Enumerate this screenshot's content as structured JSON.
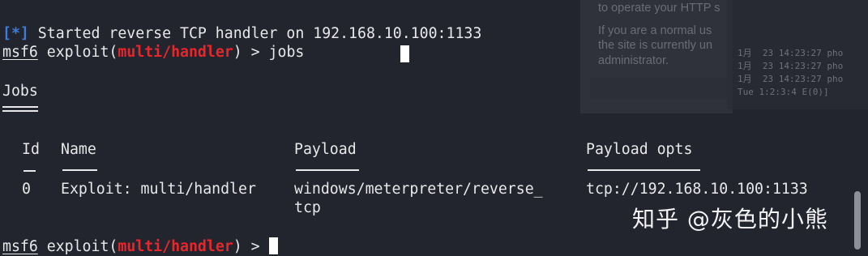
{
  "terminal": {
    "status_bracket": "[*]",
    "status_message": " Started reverse TCP handler on 192.168.10.100:1133",
    "prompt": {
      "msf": "msf6",
      "exploit_pre": " exploit(",
      "module": "multi/handler",
      "exploit_post": ") > "
    },
    "first_command": "jobs",
    "jobs_heading": "Jobs",
    "jobs_table": {
      "headers": {
        "id": "Id",
        "name": "Name",
        "payload": "Payload",
        "payload_opts": "Payload opts"
      },
      "rows": [
        {
          "id": "0",
          "name": "Exploit: multi/handler",
          "payload_line1": "windows/meterpreter/reverse_",
          "payload_line2": "tcp",
          "payload_opts": "tcp://192.168.10.100:1133"
        }
      ]
    }
  },
  "background_window": {
    "line1": "to operate your HTTP s",
    "line2": "If you are a normal us",
    "line3": "the site is currently un",
    "line4": "administrator.",
    "log1": "1月  23 14:23:27 pho",
    "log2": "1月  23 14:23:27 pho",
    "log3": "1月  23 14:23:27 pho",
    "log4": "Tue 1:2:3:4 E(0)]"
  },
  "watermark": {
    "text": "知乎 @灰色的小熊"
  },
  "colors": {
    "background": "#23252e",
    "foreground": "#e8e8ea",
    "module_red": "#e8262b",
    "status_blue": "#3d7bdc"
  }
}
